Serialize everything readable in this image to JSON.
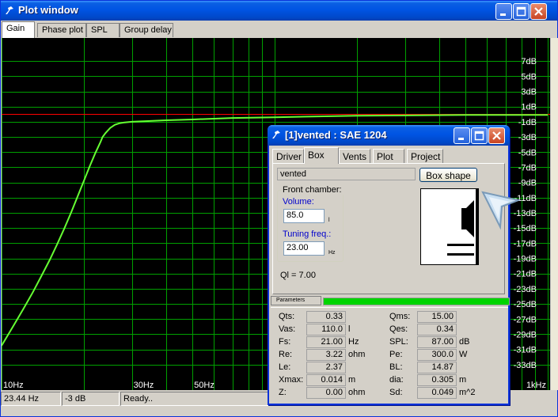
{
  "plot_window": {
    "title": "Plot window",
    "tabs": [
      {
        "label": "Gain",
        "active": true
      },
      {
        "label": "Phase plot",
        "active": false
      },
      {
        "label": "SPL",
        "active": false
      },
      {
        "label": "Group delay",
        "active": false
      }
    ],
    "status": {
      "frequency": "23.44 Hz",
      "level": "-3 dB",
      "message": "Ready.."
    }
  },
  "chart_data": {
    "type": "line",
    "y_tick_labels": [
      "7dB",
      "5dB",
      "3dB",
      "1dB",
      "-1dB",
      "-3dB",
      "-5dB",
      "-7dB",
      "-9dB",
      "-11dB",
      "-13dB",
      "-15dB",
      "-17dB",
      "-19dB",
      "-21dB",
      "-23dB",
      "-25dB",
      "-27dB",
      "-29dB",
      "-31dB",
      "-33dB"
    ],
    "x_tick_labels": [
      "10Hz",
      "30Hz",
      "50Hz",
      "1kHz"
    ],
    "x_scale": "log",
    "xlim": [
      10,
      1000
    ],
    "ylim": [
      -35,
      9
    ],
    "grid": true,
    "reference_line_db": 0,
    "series": [
      {
        "x": [
          10,
          11,
          12,
          13,
          14,
          15,
          16,
          17,
          18,
          19,
          20,
          21,
          22,
          23,
          23.44,
          24,
          25,
          26,
          27,
          28,
          30,
          35,
          40,
          50,
          70,
          100,
          200,
          500,
          1000
        ],
        "y": [
          -30.5,
          -28.0,
          -25.7,
          -23.5,
          -21.3,
          -19.2,
          -17.1,
          -15.0,
          -12.9,
          -10.8,
          -8.8,
          -6.9,
          -5.2,
          -3.7,
          -3.0,
          -2.5,
          -1.8,
          -1.4,
          -1.2,
          -1.1,
          -1.0,
          -0.9,
          -0.8,
          -0.7,
          -0.5,
          -0.4,
          -0.2,
          -0.1,
          -0.1
        ]
      }
    ],
    "colors": {
      "background": "#000000",
      "grid": "#00a000",
      "curve": "#66ff33",
      "reference": "#ff0000",
      "labels": "#ffffff"
    }
  },
  "dialog": {
    "title": "[1]vented : SAE 1204",
    "tabs": [
      {
        "label": "Driver",
        "active": false
      },
      {
        "label": "Box",
        "active": true
      },
      {
        "label": "Vents",
        "active": false
      },
      {
        "label": "Plot",
        "active": false
      },
      {
        "label": "Project",
        "active": false
      }
    ],
    "box_type": "vented",
    "box_shape_button": "Box shape",
    "front_chamber_label": "Front chamber:",
    "volume_label": "Volume:",
    "volume_value": "85.0",
    "volume_unit": "l",
    "tuning_label": "Tuning freq.:",
    "tuning_value": "23.00",
    "tuning_unit": "Hz",
    "ql": "Ql = 7.00",
    "parameters_label": "Parameters",
    "params_left": [
      {
        "label": "Qts:",
        "value": "0.33",
        "unit": ""
      },
      {
        "label": "Vas:",
        "value": "110.0",
        "unit": "l"
      },
      {
        "label": "Fs:",
        "value": "21.00",
        "unit": "Hz"
      },
      {
        "label": "Re:",
        "value": "3.22",
        "unit": "ohm"
      },
      {
        "label": "Le:",
        "value": "2.37",
        "unit": ""
      },
      {
        "label": "Xmax:",
        "value": "0.014",
        "unit": "m"
      },
      {
        "label": "Z:",
        "value": "0.00",
        "unit": "ohm"
      }
    ],
    "params_right": [
      {
        "label": "Qms:",
        "value": "15.00",
        "unit": ""
      },
      {
        "label": "Qes:",
        "value": "0.34",
        "unit": ""
      },
      {
        "label": "SPL:",
        "value": "87.00",
        "unit": "dB"
      },
      {
        "label": "Pe:",
        "value": "300.0",
        "unit": "W"
      },
      {
        "label": "BL:",
        "value": "14.87",
        "unit": ""
      },
      {
        "label": "dia:",
        "value": "0.305",
        "unit": "m"
      },
      {
        "label": "Sd:",
        "value": "0.049",
        "unit": "m^2"
      }
    ]
  }
}
